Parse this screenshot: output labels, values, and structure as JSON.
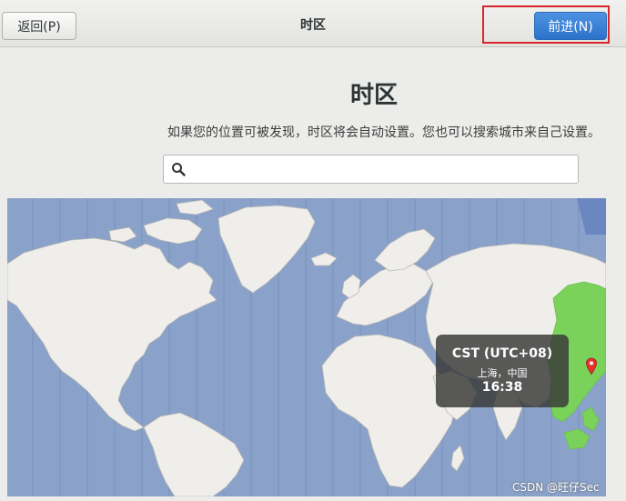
{
  "colors": {
    "accent": "#3a83d8",
    "ocean": "#8aa1c9",
    "land": "#efeeea",
    "selected_zone": "#7bd25b",
    "focus_outline": "#d9262b"
  },
  "header": {
    "back_label": "返回(P)",
    "title": "时区",
    "next_label": "前进(N)"
  },
  "main": {
    "heading": "时区",
    "description": "如果您的位置可被发现，时区将会自动设置。您也可以搜索城市来自己设置。",
    "search": {
      "icon": "search-icon",
      "value": "",
      "placeholder": ""
    }
  },
  "map": {
    "selected": {
      "timezone": "CST (UTC+08)",
      "location": "上海，中国",
      "time": "16:38"
    },
    "pin_icon": "location-pin-icon"
  },
  "watermark": "CSDN @旺仔Sec"
}
